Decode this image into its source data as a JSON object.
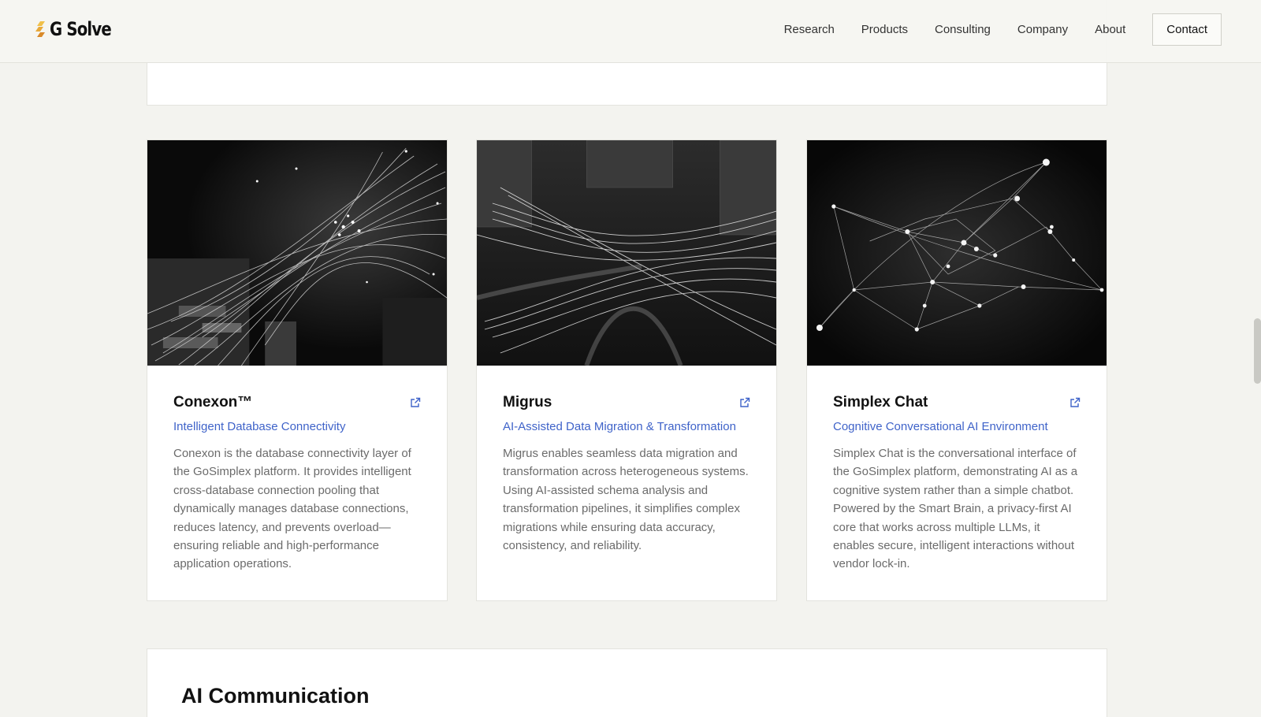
{
  "brand": {
    "name": "G Solve"
  },
  "nav": {
    "items": [
      "Research",
      "Products",
      "Consulting",
      "Company",
      "About"
    ],
    "contact_label": "Contact"
  },
  "products": [
    {
      "title": "Conexon™",
      "subtitle": "Intelligent Database Connectivity",
      "description": "Conexon is the database connectivity layer of the GoSimplex platform. It provides intelligent cross-database connection pooling that dynamically manages database connections, reduces latency, and prevents overload—ensuring reliable and high-performance application operations.",
      "icon": "external-link-icon"
    },
    {
      "title": "Migrus",
      "subtitle": "AI-Assisted Data Migration & Transformation",
      "description": "Migrus enables seamless data migration and transformation across heterogeneous systems. Using AI-assisted schema analysis and transformation pipelines, it simplifies complex migrations while ensuring data accuracy, consistency, and reliability.",
      "icon": "external-link-icon"
    },
    {
      "title": "Simplex Chat",
      "subtitle": "Cognitive Conversational AI Environment",
      "description": "Simplex Chat is the conversational interface of the GoSimplex platform, demonstrating AI as a cognitive system rather than a simple chatbot. Powered by the Smart Brain, a privacy-first AI core that works across multiple LLMs, it enables secure, intelligent interactions without vendor lock-in.",
      "icon": "external-link-icon"
    }
  ],
  "section": {
    "title": "AI Communication"
  },
  "colors": {
    "accent": "#3f63c9",
    "background": "#f3f3ef",
    "logo_gold": "#e8a93a"
  }
}
